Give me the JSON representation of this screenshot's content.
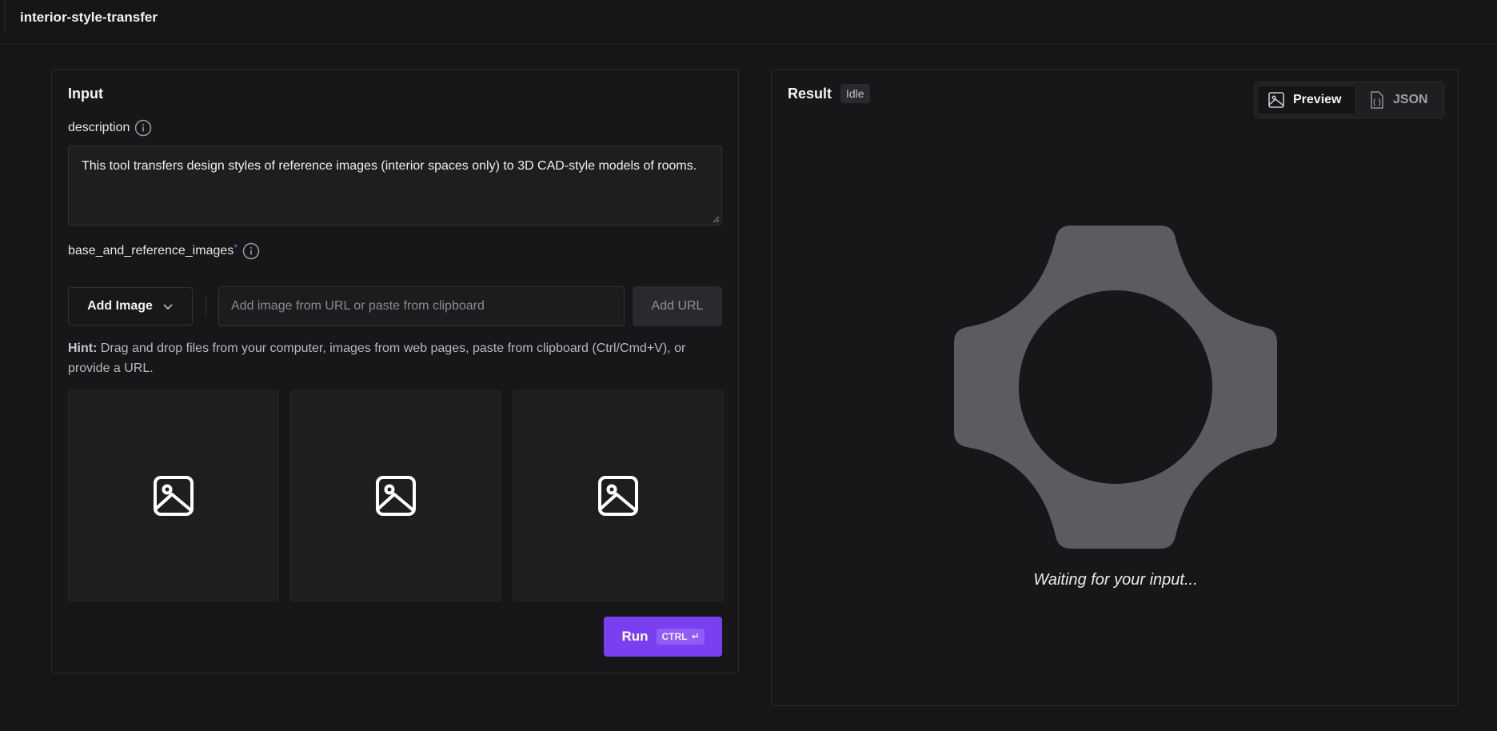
{
  "app": {
    "title": "interior-style-transfer"
  },
  "input": {
    "title": "Input",
    "description": {
      "label": "description",
      "value": "This tool transfers design styles of reference images (interior spaces only) to 3D CAD-style models of rooms."
    },
    "images": {
      "label": "base_and_reference_images",
      "required_mark": "*",
      "add_image_label": "Add Image",
      "url_placeholder": "Add image from URL or paste from clipboard",
      "add_url_label": "Add URL",
      "hint_prefix": "Hint:",
      "hint_text": " Drag and drop files from your computer, images from web pages, paste from clipboard (Ctrl/Cmd+V), or provide a URL.",
      "slots": [
        "image-icon",
        "image-icon",
        "image-icon"
      ]
    },
    "run": {
      "label": "Run",
      "shortcut": "CTRL",
      "shortcut_icon": "enter-icon"
    }
  },
  "result": {
    "title": "Result",
    "status": "Idle",
    "tabs": [
      {
        "label": "Preview",
        "icon": "image-icon",
        "active": true
      },
      {
        "label": "JSON",
        "icon": "json-file-icon",
        "active": false
      }
    ],
    "waiting_text": "Waiting for your input..."
  },
  "colors": {
    "background": "#161618",
    "accent": "#7b3ff2",
    "placeholder_shape": "#5b5b62"
  }
}
